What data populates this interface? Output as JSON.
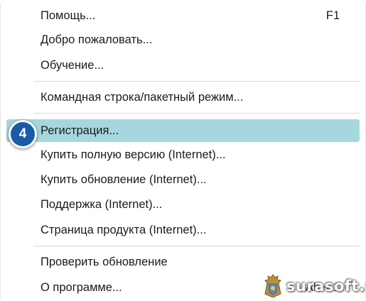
{
  "menu": {
    "items": [
      {
        "label": "Помощь...",
        "shortcut": "F1"
      },
      {
        "label": "Добро пожаловать...",
        "shortcut": ""
      },
      {
        "label": "Обучение...",
        "shortcut": ""
      },
      {
        "label": "Командная строка/пакетный режим...",
        "shortcut": ""
      },
      {
        "label": "Регистрация...",
        "shortcut": "",
        "highlighted": true
      },
      {
        "label": "Купить полную версию (Internet)...",
        "shortcut": ""
      },
      {
        "label": "Купить обновление (Internet)...",
        "shortcut": ""
      },
      {
        "label": "Поддержка (Internet)...",
        "shortcut": ""
      },
      {
        "label": "Страница продукта (Internet)...",
        "shortcut": ""
      },
      {
        "label": "Проверить обновление",
        "shortcut": ""
      },
      {
        "label": "О программе...",
        "shortcut": "Alt+F1"
      }
    ]
  },
  "step_badge": "4",
  "watermark": {
    "text": "surasoft.ru",
    "icon": "coat-of-arms-icon"
  },
  "colors": {
    "highlight": "#a6d7df",
    "badge": "#1a5aa6",
    "separator": "#d9d9d9"
  }
}
